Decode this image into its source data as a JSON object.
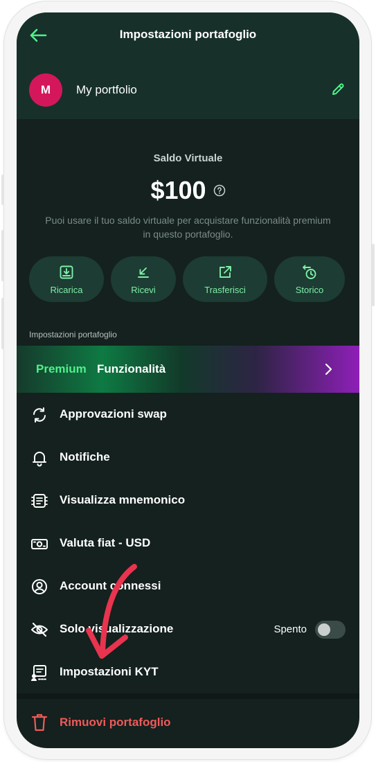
{
  "header": {
    "title": "Impostazioni portafoglio"
  },
  "portfolio": {
    "avatar_letter": "M",
    "name": "My portfolio"
  },
  "balance": {
    "label": "Saldo Virtuale",
    "amount": "$100",
    "description": "Puoi usare il tuo saldo virtuale per acquistare funzionalità premium in questo portafoglio."
  },
  "actions": [
    {
      "label": "Ricarica",
      "icon": "deposit-icon"
    },
    {
      "label": "Ricevi",
      "icon": "receive-arrow-icon"
    },
    {
      "label": "Trasferisci",
      "icon": "transfer-out-icon"
    },
    {
      "label": "Storico",
      "icon": "history-clock-icon"
    }
  ],
  "section_label": "Impostazioni portafoglio",
  "premium": {
    "highlight": "Premium",
    "label": "Funzionalità"
  },
  "menu": [
    {
      "label": "Approvazioni swap",
      "icon": "refresh-cycle-icon"
    },
    {
      "label": "Notifiche",
      "icon": "bell-icon"
    },
    {
      "label": "Visualizza mnemonico",
      "icon": "mnemonic-icon"
    },
    {
      "label": "Valuta fiat - USD",
      "icon": "banknote-icon"
    },
    {
      "label": "Account connessi",
      "icon": "account-circle-icon"
    },
    {
      "label": "Solo visualizzazione",
      "icon": "eye-off-icon",
      "state": "Spento",
      "toggle_on": false
    },
    {
      "label": "Impostazioni KYT",
      "icon": "kyt-icon"
    }
  ],
  "remove": {
    "label": "Rimuovi portafoglio",
    "icon": "trash-icon"
  },
  "colors": {
    "accent_green": "#4ef28a",
    "danger_red": "#ef5a5a",
    "avatar": "#d4175a",
    "annotation_arrow": "#e8344f"
  }
}
